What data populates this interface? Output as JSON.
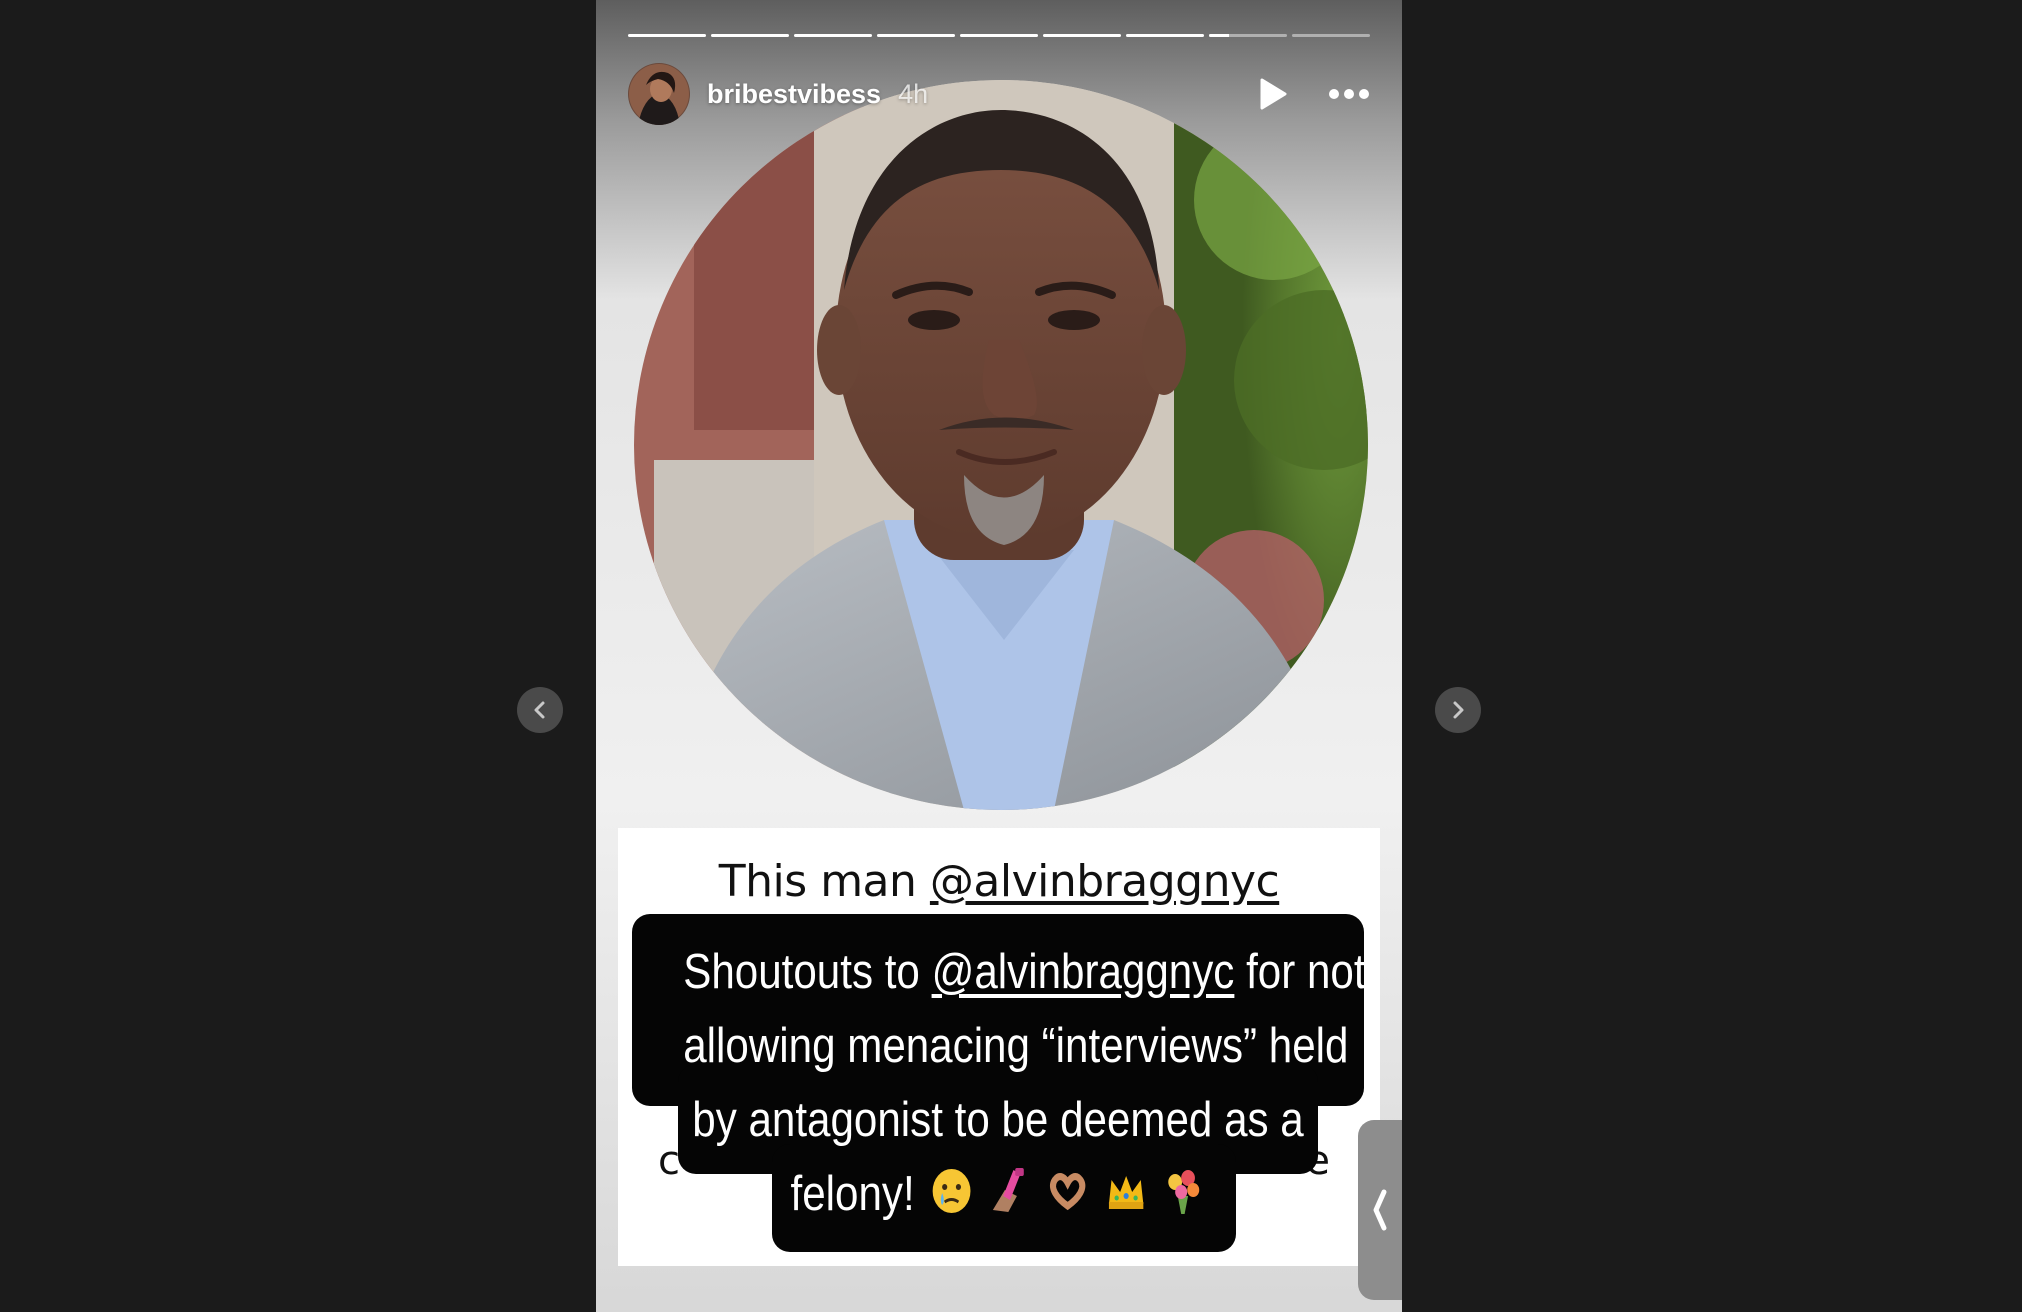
{
  "story": {
    "username": "bribestvibess",
    "timestamp": "4h",
    "progress_segments": [
      1,
      1,
      1,
      1,
      1,
      1,
      1,
      0.25,
      0
    ]
  },
  "card": {
    "prefix_text": "This man ",
    "mention": "@alvinbraggnyc",
    "hidden_left": "c",
    "hidden_right": "e"
  },
  "caption": {
    "line1_prefix": "Shoutouts to ",
    "line1_mention": "@alvinbraggnyc",
    "line1_suffix": " for not",
    "line2": "allowing menacing “interviews” held",
    "line3": "by antagonist to be deemed as a",
    "line4": "felony!",
    "emojis": [
      "teary-face-icon",
      "nail-polish-icon",
      "heart-hands-icon",
      "crown-icon",
      "bouquet-icon"
    ]
  },
  "colors": {
    "page_background": "#1b1b1b",
    "caption_background": "#050505",
    "card_background": "#ffffff"
  }
}
